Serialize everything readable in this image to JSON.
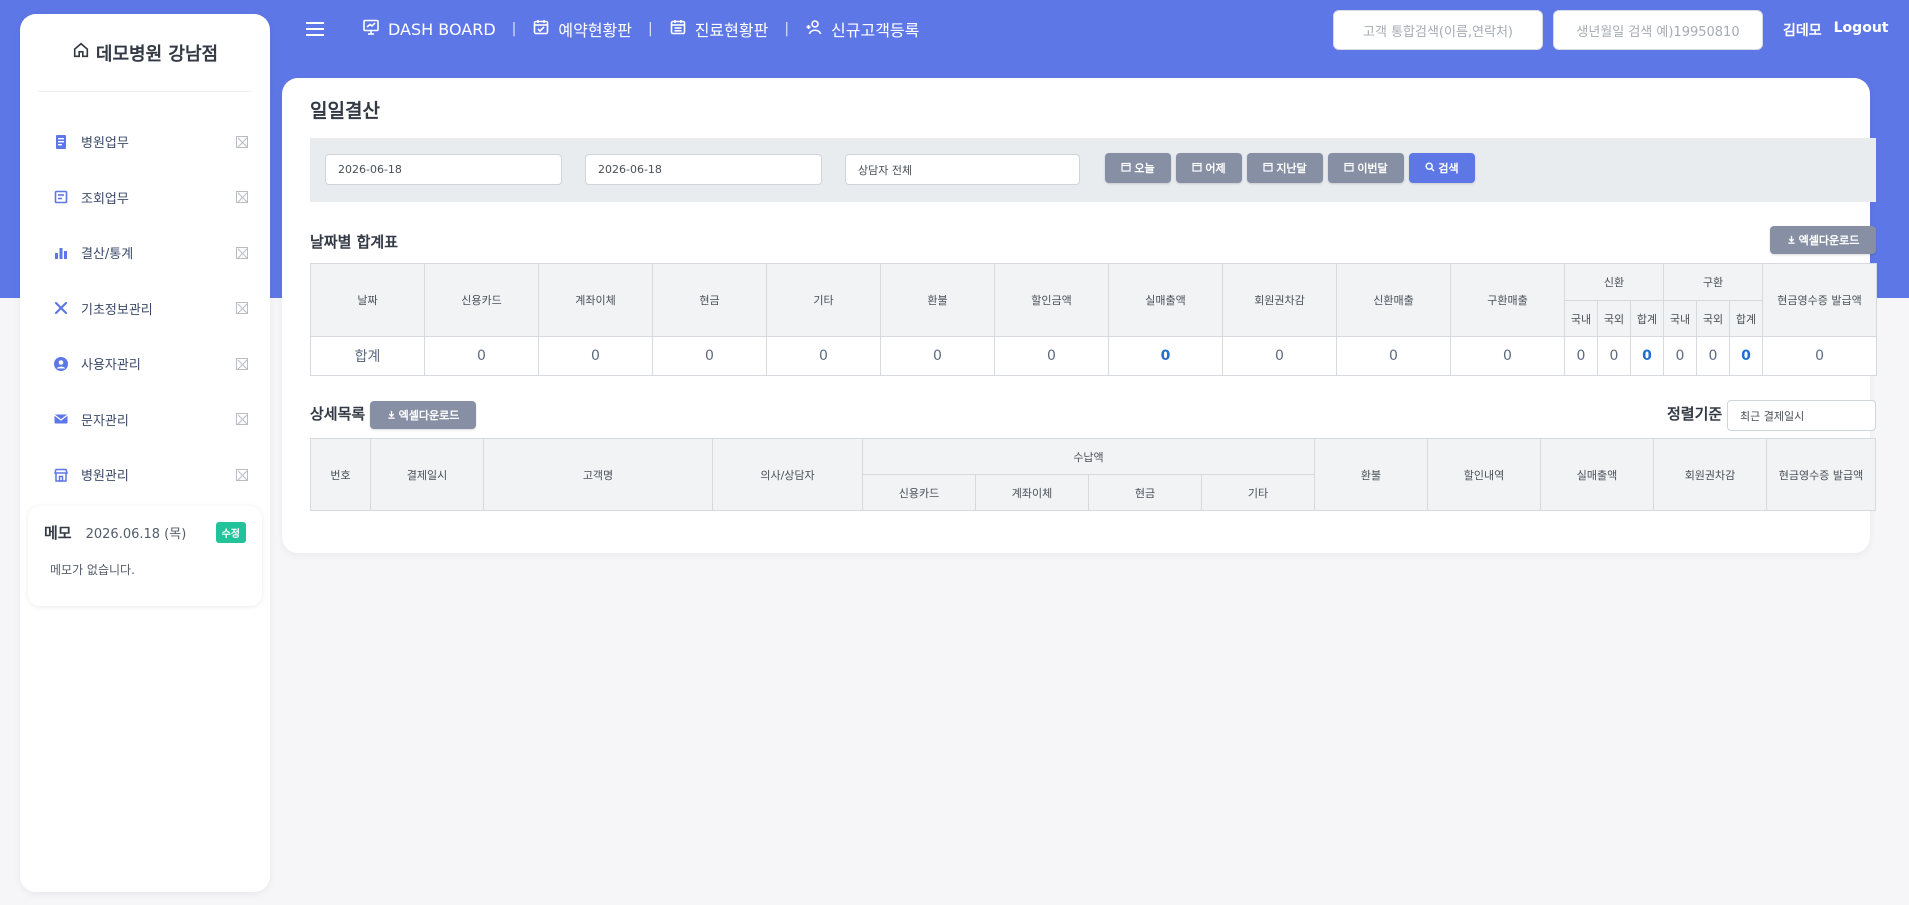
{
  "sidebar": {
    "brand": "데모병원 강남점",
    "items": [
      {
        "label": "병원업무",
        "icon": "document-icon"
      },
      {
        "label": "조회업무",
        "icon": "list-icon"
      },
      {
        "label": "결산/통계",
        "icon": "bar-chart-icon"
      },
      {
        "label": "기초정보관리",
        "icon": "tools-icon"
      },
      {
        "label": "사용자관리",
        "icon": "user-circle-icon"
      },
      {
        "label": "문자관리",
        "icon": "envelope-icon"
      },
      {
        "label": "병원관리",
        "icon": "building-icon"
      }
    ],
    "memo": {
      "title": "메모",
      "date": "2026.06.18 (목)",
      "edit_label": "수정",
      "body": "메모가 없습니다."
    }
  },
  "topnav": {
    "links": [
      {
        "label": "DASH BOARD",
        "icon": "presentation-icon"
      },
      {
        "label": "예약현황판",
        "icon": "calendar-check-icon"
      },
      {
        "label": "진료현황판",
        "icon": "calendar-icon"
      },
      {
        "label": "신규고객등록",
        "icon": "user-add-icon"
      }
    ],
    "separator": "|",
    "search_placeholder": "고객 통합검색(이름,연락처)",
    "birth_placeholder": "생년월일 검색 예)19950810",
    "user_name": "김데모",
    "logout_label": "Logout"
  },
  "page": {
    "title": "일일결산",
    "filter": {
      "start_date": "2026-06-18",
      "end_date": "2026-06-18",
      "counselor": "상담자 전체",
      "buttons": [
        "오늘",
        "어제",
        "지난달",
        "이번달"
      ],
      "search_label": "검색"
    },
    "summary": {
      "title": "날짜별 합계표",
      "excel_label": "엑셀다운로드",
      "headers": [
        "날짜",
        "신용카드",
        "계좌이체",
        "현금",
        "기타",
        "환불",
        "할인금액",
        "실매출액",
        "회원권차감",
        "신환매출",
        "구환매출"
      ],
      "group_new": "신환",
      "group_old": "구환",
      "sub_headers": [
        "국내",
        "국외",
        "합계"
      ],
      "receipt_header": "현금영수증 발급액",
      "row_label": "합계",
      "row_values": [
        "0",
        "0",
        "0",
        "0",
        "0",
        "0",
        "0",
        "0",
        "0",
        "0"
      ],
      "new_values": [
        "0",
        "0",
        "0"
      ],
      "old_values": [
        "0",
        "0",
        "0"
      ],
      "receipt_value": "0"
    },
    "detail": {
      "title": "상세목록",
      "excel_label": "엑셀다운로드",
      "sort_label": "정렬기준",
      "sort_value": "최근 결제일시",
      "headers": {
        "no": "번호",
        "paid_at": "결제일시",
        "customer": "고객명",
        "doctor": "의사/상담자",
        "payment_group": "수납액",
        "payment_subs": [
          "신용카드",
          "계좌이체",
          "현금",
          "기타"
        ],
        "refund": "환불",
        "discount": "할인내역",
        "net_sales": "실매출액",
        "membership": "회원권차감",
        "receipt": "현금영수증 발급액"
      }
    }
  },
  "colors": {
    "primary": "#5e77e6",
    "secondary_button": "#868fa4",
    "memo_button": "#22c39a",
    "highlight_value": "#1f6fd1"
  }
}
